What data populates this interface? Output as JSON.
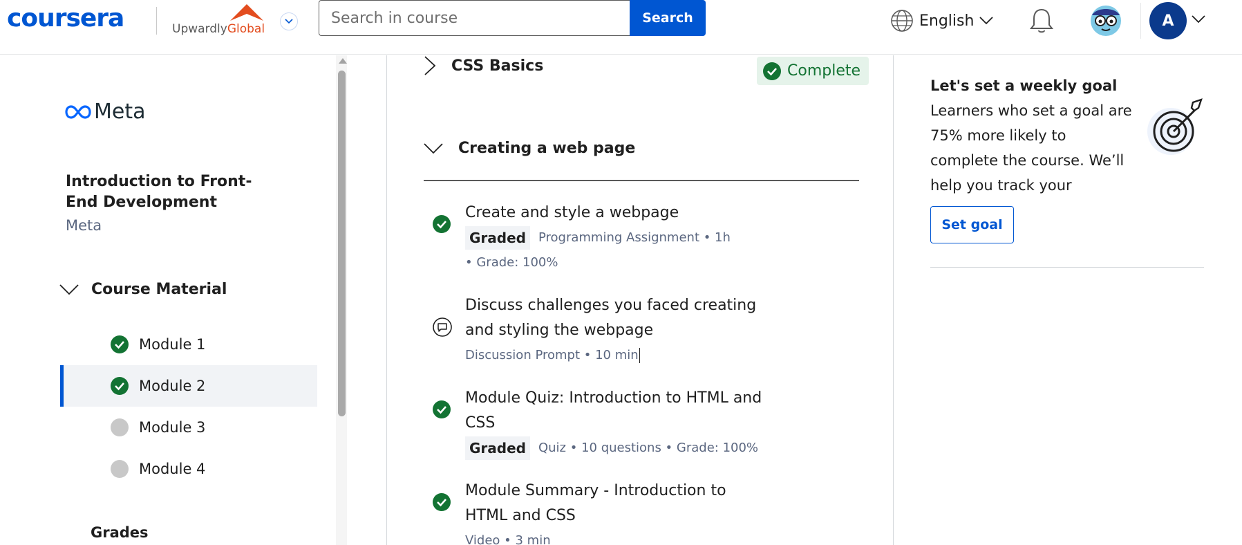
{
  "header": {
    "logo": "coursera",
    "partner": {
      "prefix": "Upwardly",
      "suffix": "Global"
    },
    "search": {
      "placeholder": "Search in course",
      "button_label": "Search"
    },
    "language": "English",
    "avatar_initial": "A"
  },
  "sidebar": {
    "brand": "Meta",
    "course_title": "Introduction to Front-End Development",
    "course_org": "Meta",
    "section_label": "Course Material",
    "modules": [
      {
        "label": "Module 1",
        "status": "complete"
      },
      {
        "label": "Module 2",
        "status": "complete",
        "active": true
      },
      {
        "label": "Module 3",
        "status": "incomplete"
      },
      {
        "label": "Module 4",
        "status": "incomplete"
      }
    ],
    "grades_label": "Grades"
  },
  "main": {
    "lesson1": {
      "title": "CSS Basics",
      "badge": "Complete"
    },
    "lesson2": {
      "title": "Creating a web page"
    },
    "items": [
      {
        "title": "Create and style a webpage",
        "graded": "Graded",
        "meta": "Programming Assignment • 1h",
        "meta2": "• Grade: 100%",
        "icon": "check-icon"
      },
      {
        "title": "Discuss challenges you faced creating and styling the webpage",
        "meta": "Discussion Prompt • 10 min",
        "icon": "discussion-icon"
      },
      {
        "title": "Module Quiz: Introduction to HTML and CSS",
        "graded": "Graded",
        "meta": "Quiz • 10 questions • Grade: 100%",
        "icon": "check-icon"
      },
      {
        "title": "Module Summary - Introduction to HTML and CSS",
        "meta": "Video • 3 min",
        "icon": "check-icon"
      }
    ]
  },
  "right": {
    "goal_title": "Let's set a weekly goal",
    "goal_desc": "Learners who set a goal are 75% more likely to complete the course. We’ll help you track your progress.",
    "goal_button": "Set goal"
  },
  "colors": {
    "brand": "#0056d2",
    "complete": "#137333",
    "partner_accent": "#e34d1f"
  }
}
